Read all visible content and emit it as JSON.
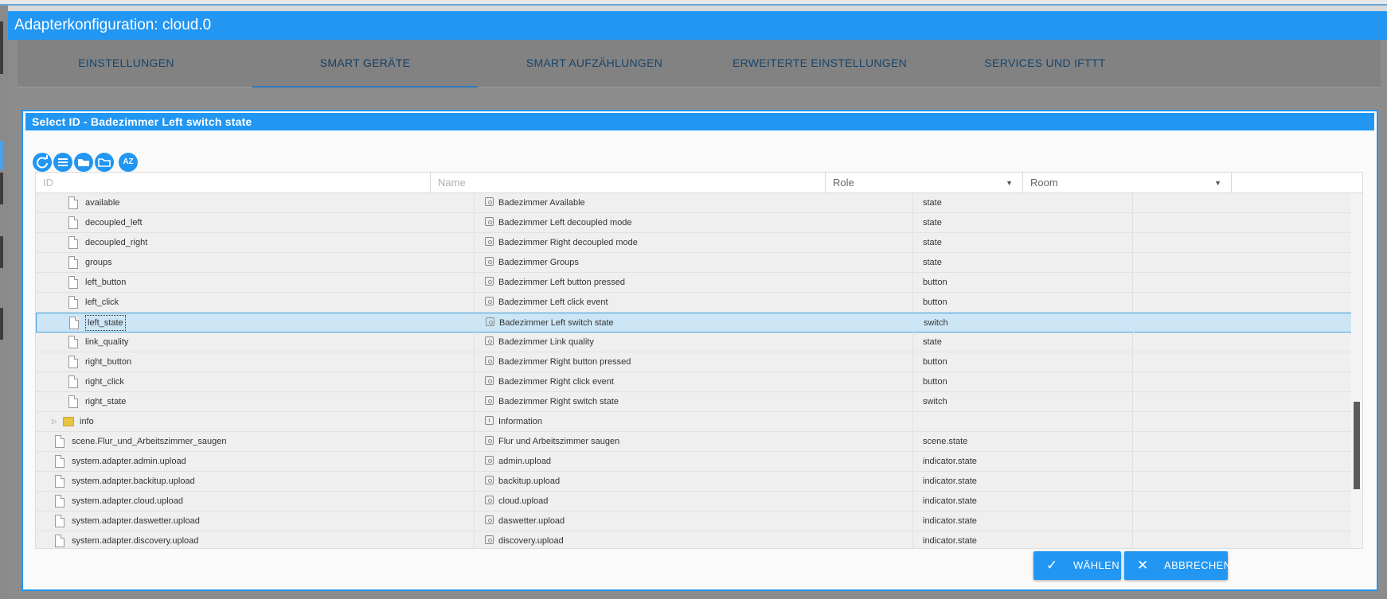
{
  "window": {
    "title": "Adapterkonfiguration: cloud.0"
  },
  "tabs": [
    {
      "label": "EINSTELLUNGEN"
    },
    {
      "label": "SMART GERÄTE"
    },
    {
      "label": "SMART AUFZÄHLUNGEN"
    },
    {
      "label": "ERWEITERTE EINSTELLUNGEN"
    },
    {
      "label": "SERVICES UND IFTTT"
    }
  ],
  "dialog": {
    "title": "Select ID - Badezimmer Left switch state",
    "toolbar": [
      "refresh-icon",
      "list-icon",
      "folder-open-icon",
      "folder-icon",
      "sort-az-icon"
    ],
    "toolbar_glyphs": {
      "sort": "AZ"
    },
    "columns": {
      "id": "ID",
      "name": "Name",
      "role": "Role",
      "room": "Room"
    },
    "rows": [
      {
        "id": "available",
        "name": "Badezimmer Available",
        "role": "state",
        "room": ""
      },
      {
        "id": "decoupled_left",
        "name": "Badezimmer Left decoupled mode",
        "role": "state",
        "room": ""
      },
      {
        "id": "decoupled_right",
        "name": "Badezimmer Right decoupled mode",
        "role": "state",
        "room": ""
      },
      {
        "id": "groups",
        "name": "Badezimmer Groups",
        "role": "state",
        "room": ""
      },
      {
        "id": "left_button",
        "name": "Badezimmer Left button pressed",
        "role": "button",
        "room": ""
      },
      {
        "id": "left_click",
        "name": "Badezimmer Left click event",
        "role": "button",
        "room": ""
      },
      {
        "id": "left_state",
        "name": "Badezimmer Left switch state",
        "role": "switch",
        "room": ""
      },
      {
        "id": "link_quality",
        "name": "Badezimmer Link quality",
        "role": "state",
        "room": ""
      },
      {
        "id": "right_button",
        "name": "Badezimmer Right button pressed",
        "role": "button",
        "room": ""
      },
      {
        "id": "right_click",
        "name": "Badezimmer Right click event",
        "role": "button",
        "room": ""
      },
      {
        "id": "right_state",
        "name": "Badezimmer Right switch state",
        "role": "switch",
        "room": ""
      },
      {
        "id": "info",
        "name": "Information",
        "role": "",
        "room": ""
      },
      {
        "id": "scene.Flur_und_Arbeitszimmer_saugen",
        "name": "Flur und Arbeitszimmer saugen",
        "role": "scene.state",
        "room": ""
      },
      {
        "id": "system.adapter.admin.upload",
        "name": "admin.upload",
        "role": "indicator.state",
        "room": ""
      },
      {
        "id": "system.adapter.backitup.upload",
        "name": "backitup.upload",
        "role": "indicator.state",
        "room": ""
      },
      {
        "id": "system.adapter.cloud.upload",
        "name": "cloud.upload",
        "role": "indicator.state",
        "room": ""
      },
      {
        "id": "system.adapter.daswetter.upload",
        "name": "daswetter.upload",
        "role": "indicator.state",
        "room": ""
      },
      {
        "id": "system.adapter.discovery.upload",
        "name": "discovery.upload",
        "role": "indicator.state",
        "room": ""
      }
    ],
    "buttons": {
      "ok": "WÄHLEN",
      "cancel": "ABBRECHEN"
    }
  }
}
